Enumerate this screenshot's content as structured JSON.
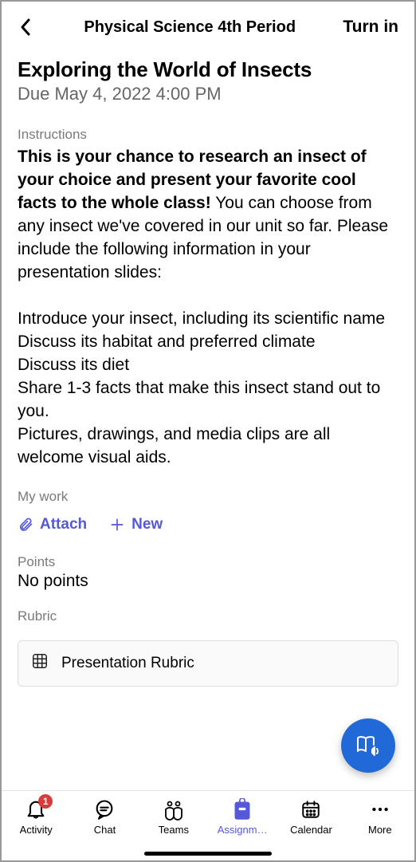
{
  "header": {
    "title": "Physical Science 4th Period",
    "turnin": "Turn in"
  },
  "assignment": {
    "title": "Exploring the World of Insects",
    "due": "Due May 4, 2022 4:00 PM",
    "instructions_label": "Instructions",
    "bold_intro": "This is your chance to research an insect of your choice and present your favorite cool facts to the whole class!",
    "rest_intro": " You can choose from any insect we've covered in our unit so far. Please include the following information in your presentation slides:",
    "lines": [
      "Introduce your insect, including its scientific name",
      "Discuss its habitat and preferred climate",
      "Discuss its diet",
      "Share 1-3 facts that make this insect stand out to you.",
      "Pictures, drawings, and media clips are all welcome visual aids."
    ]
  },
  "mywork": {
    "label": "My work",
    "attach": "Attach",
    "new": "New"
  },
  "points": {
    "label": "Points",
    "value": "No points"
  },
  "rubric": {
    "label": "Rubric",
    "name": "Presentation Rubric"
  },
  "tabs": {
    "activity": "Activity",
    "activity_badge": "1",
    "chat": "Chat",
    "teams": "Teams",
    "assignments": "Assignm…",
    "calendar": "Calendar",
    "more": "More"
  }
}
